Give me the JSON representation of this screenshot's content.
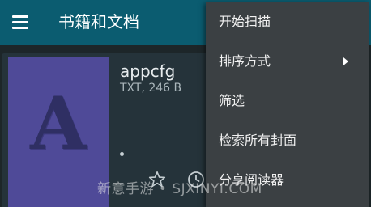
{
  "appbar": {
    "title": "书籍和文档",
    "menu_icon": "hamburger-menu-icon",
    "color": "#0b5c70"
  },
  "book": {
    "title": "appcfg",
    "meta": "TXT, 246 B",
    "cover_letter": "A",
    "cover_color": "#4f4a98",
    "favorite_icon": "star-outline-icon",
    "history_icon": "clock-icon"
  },
  "menu": {
    "items": [
      {
        "label": "开始扫描"
      },
      {
        "label": "排序方式",
        "has_submenu": true
      },
      {
        "label": "筛选"
      },
      {
        "label": "检索所有封面"
      },
      {
        "label": "分享阅读器"
      }
    ]
  },
  "watermark": "新意手游 • SJXINYI.COM"
}
